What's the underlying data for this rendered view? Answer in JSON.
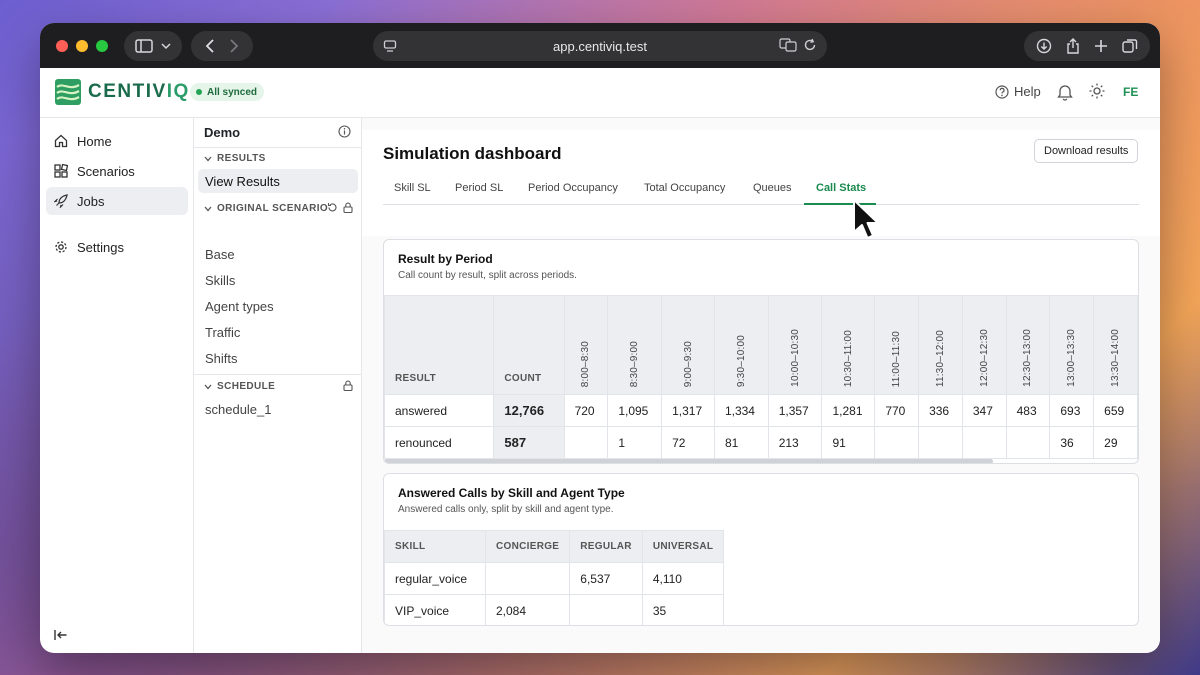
{
  "browser": {
    "url": "app.centiviq.test"
  },
  "app": {
    "logo_text_1": "CENTIV",
    "logo_text_2": "IQ",
    "sync_status": "All synced",
    "help_label": "Help",
    "user_initials": "FE",
    "accent_color": "#1a8a4e"
  },
  "leftnav": {
    "items": [
      {
        "label": "Home",
        "icon": "home-icon"
      },
      {
        "label": "Scenarios",
        "icon": "scenarios-icon"
      },
      {
        "label": "Jobs",
        "icon": "rocket-icon",
        "active": true
      },
      {
        "label": "Settings",
        "icon": "gear-icon"
      }
    ]
  },
  "midpanel": {
    "title": "Demo",
    "results_section": "RESULTS",
    "results_items": [
      "View Results"
    ],
    "scenario_section": "ORIGINAL SCENARIO",
    "scenario_items": [
      "Base",
      "Skills",
      "Agent types",
      "Traffic",
      "Shifts"
    ],
    "schedule_section": "SCHEDULE",
    "schedule_items": [
      "schedule_1"
    ]
  },
  "main": {
    "title": "Simulation dashboard",
    "download_label": "Download results",
    "tabs": [
      "Skill SL",
      "Period SL",
      "Period Occupancy",
      "Total Occupancy",
      "Queues",
      "Call Stats"
    ],
    "active_tab": "Call Stats"
  },
  "result_by_period": {
    "title": "Result by Period",
    "subtitle": "Call count by result, split across periods.",
    "col_result": "RESULT",
    "col_count": "COUNT",
    "periods": [
      "8:00–8:30",
      "8:30–9:00",
      "9:00–9:30",
      "9:30–10:00",
      "10:00–10:30",
      "10:30–11:00",
      "11:00–11:30",
      "11:30–12:00",
      "12:00–12:30",
      "12:30–13:00",
      "13:00–13:30",
      "13:30–14:00"
    ],
    "rows": [
      {
        "result": "answered",
        "count": "12,766",
        "values": [
          "720",
          "1,095",
          "1,317",
          "1,334",
          "1,357",
          "1,281",
          "770",
          "336",
          "347",
          "483",
          "693",
          "659"
        ]
      },
      {
        "result": "renounced",
        "count": "587",
        "values": [
          "",
          "1",
          "72",
          "81",
          "213",
          "91",
          "",
          "",
          "",
          "",
          "36",
          "29"
        ]
      }
    ]
  },
  "answered_by_skill": {
    "title": "Answered Calls by Skill and Agent Type",
    "subtitle": "Answered calls only, split by skill and agent type.",
    "columns": [
      "SKILL",
      "CONCIERGE",
      "REGULAR",
      "UNIVERSAL"
    ],
    "rows": [
      [
        "regular_voice",
        "",
        "6,537",
        "4,110"
      ],
      [
        "VIP_voice",
        "2,084",
        "",
        "35"
      ]
    ]
  }
}
